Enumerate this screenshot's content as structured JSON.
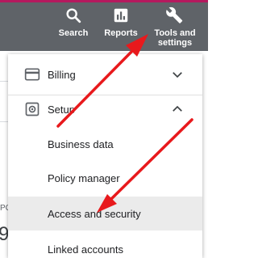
{
  "header": {
    "nav": [
      {
        "label": "Search",
        "icon": "search-icon"
      },
      {
        "label": "Reports",
        "icon": "reports-icon"
      },
      {
        "label_line1": "Tools and",
        "label_line2": "settings",
        "icon": "wrench-icon"
      }
    ]
  },
  "menu": {
    "billing": {
      "label": "Billing",
      "icon": "billing-card-icon",
      "chevron": "chevron-down-icon"
    },
    "setup": {
      "label": "Setup",
      "icon": "gear-icon",
      "chevron": "chevron-up-icon"
    },
    "setup_items": [
      {
        "label": "Business data"
      },
      {
        "label": "Policy manager"
      },
      {
        "label": "Access and security",
        "highlighted": true
      },
      {
        "label": "Linked accounts"
      }
    ]
  },
  "background": {
    "partial_text_1": "PC",
    "partial_text_2": "9"
  },
  "colors": {
    "topbar": "#5f6368",
    "accent": "#b5195e",
    "annotation_arrow": "#e8191c",
    "highlight": "#ebebeb"
  }
}
